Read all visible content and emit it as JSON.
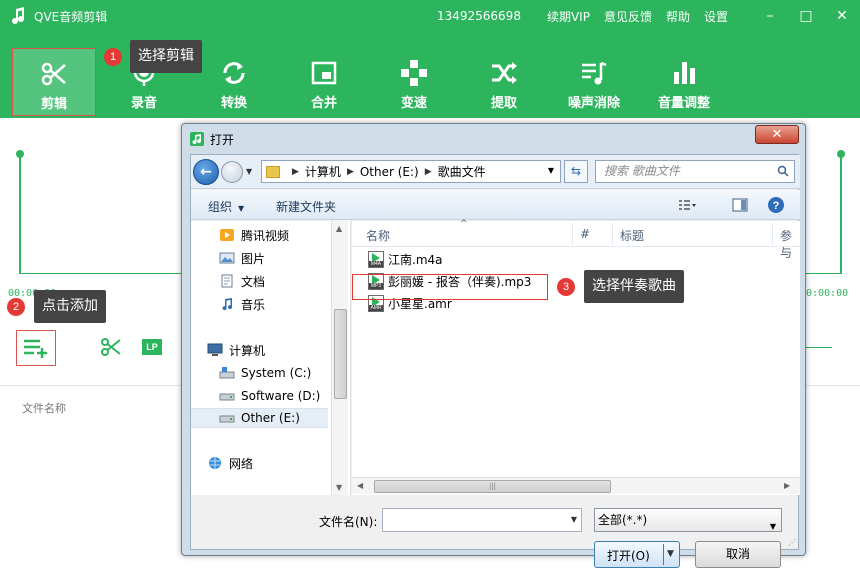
{
  "app": {
    "title": "QVE音频剪辑",
    "phone": "13492566698",
    "menu": [
      "续期VIP",
      "意见反馈",
      "帮助",
      "设置"
    ],
    "window_controls": [
      "–",
      "□",
      "✕"
    ]
  },
  "toolbar": {
    "tools": [
      {
        "label": "剪辑",
        "icon": "scissors-icon",
        "active": true
      },
      {
        "label": "录音",
        "icon": "microphone-icon",
        "active": false
      },
      {
        "label": "转换",
        "icon": "convert-icon",
        "active": false
      },
      {
        "label": "合并",
        "icon": "merge-icon",
        "active": false
      },
      {
        "label": "变速",
        "icon": "speed-icon",
        "active": false
      },
      {
        "label": "提取",
        "icon": "extract-icon",
        "active": false
      },
      {
        "label": "噪声消除",
        "icon": "denoise-icon",
        "active": false
      },
      {
        "label": "音量调整",
        "icon": "volume-bars-icon",
        "active": false
      }
    ]
  },
  "callouts": {
    "c1": {
      "num": "1",
      "text": "选择剪辑"
    },
    "c2": {
      "num": "2",
      "text": "点击添加"
    },
    "c3": {
      "num": "3",
      "text": "选择伴奏歌曲"
    }
  },
  "workspace": {
    "time_left": "00:00:00",
    "time_right": "00:00:00",
    "lp_label": "LP",
    "column_filename": "文件名称"
  },
  "dialog": {
    "title": "打开",
    "close": "✕",
    "address": {
      "parts": [
        "计算机",
        "Other (E:)",
        "歌曲文件"
      ]
    },
    "search_placeholder": "搜索 歌曲文件",
    "commands": {
      "organize": "组织",
      "new_folder": "新建文件夹"
    },
    "nav": {
      "tencent": "腾讯视频",
      "pictures": "图片",
      "documents": "文档",
      "music": "音乐",
      "computer": "计算机",
      "system_c": "System (C:)",
      "software_d": "Software (D:)",
      "other_e": "Other (E:)",
      "network": "网络"
    },
    "columns": {
      "name": "名称",
      "number": "#",
      "title": "标题",
      "contributing": "参与"
    },
    "files": [
      {
        "name": "江南.m4a",
        "ext": "M4A"
      },
      {
        "name": "彭丽媛 - 报答（伴奏).mp3",
        "ext": "MP3"
      },
      {
        "name": "小星星.amr",
        "ext": "AMR"
      }
    ],
    "filename_label": "文件名(N):",
    "filename_value": "",
    "filetype": "全部(*.*)",
    "open_label": "打开(O)",
    "cancel_label": "取消"
  },
  "colors": {
    "brand_green": "#2db55d",
    "callout_red": "#e53935",
    "tip_bg": "#444444"
  }
}
